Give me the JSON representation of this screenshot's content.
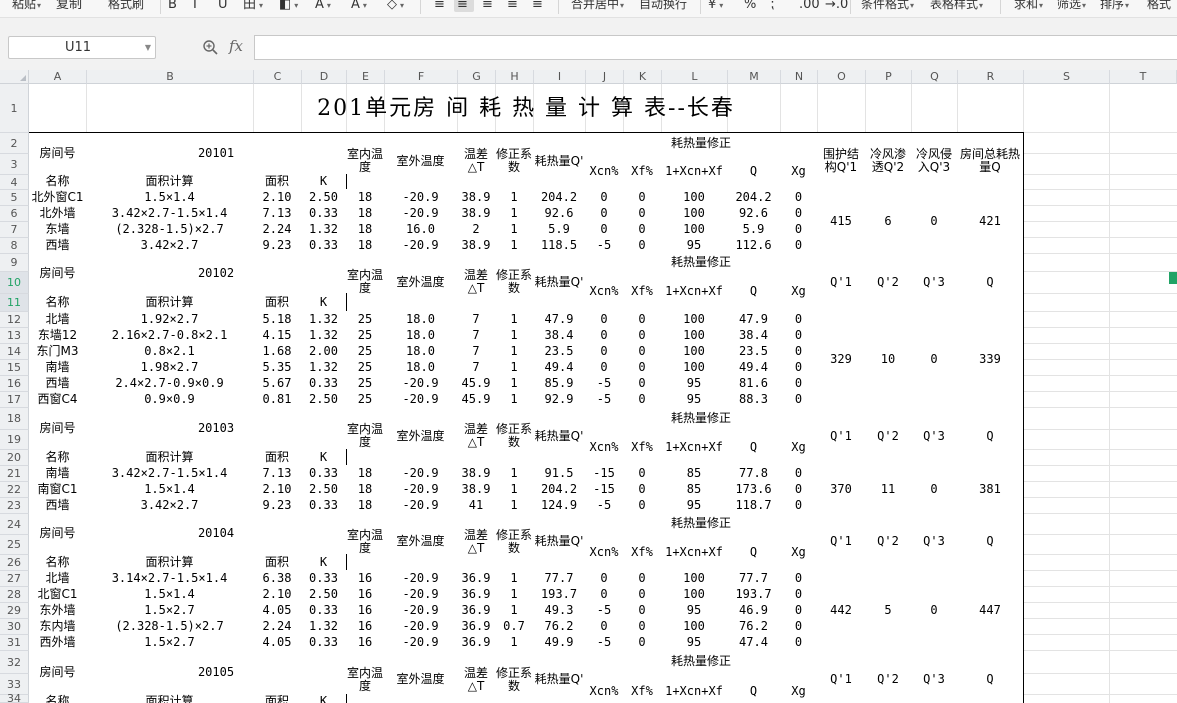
{
  "ribbon": [
    {
      "label": "粘贴",
      "has_caret": true
    },
    {
      "label": "复制",
      "icon": "copy-icon"
    },
    {
      "label": "格式刷"
    },
    {
      "label": "B",
      "icon": "bold-icon"
    },
    {
      "label": "I",
      "icon": "italic-icon"
    },
    {
      "label": "U",
      "icon": "underline-icon"
    },
    {
      "label": "田",
      "icon": "border-icon",
      "has_caret": true
    },
    {
      "label": "◧",
      "icon": "fill-color-icon",
      "has_caret": true
    },
    {
      "label": "A",
      "icon": "highlight-icon",
      "has_caret": true
    },
    {
      "label": "A",
      "icon": "font-color-icon",
      "has_caret": true
    },
    {
      "label": "◇",
      "icon": "clear-format-icon",
      "has_caret": true
    },
    {
      "label": "≡",
      "icon": "align-left-icon"
    },
    {
      "label": "≡",
      "icon": "align-center-icon"
    },
    {
      "label": "≡",
      "icon": "align-right-icon"
    },
    {
      "label": "≡",
      "icon": "justify-icon"
    },
    {
      "label": "≡",
      "icon": "distributed-icon"
    },
    {
      "label": "合并居中",
      "has_caret": true
    },
    {
      "label": "自动换行"
    },
    {
      "label": "¥",
      "icon": "currency-icon",
      "has_caret": true
    },
    {
      "label": "%",
      "icon": "percent-icon"
    },
    {
      "label": "⁏",
      "icon": "thousands-icon"
    },
    {
      "label": ".00",
      "icon": "increase-decimal-icon"
    },
    {
      "label": "→.0",
      "icon": "decrease-decimal-icon"
    },
    {
      "label": "条件格式",
      "has_caret": true
    },
    {
      "label": "表格样式",
      "has_caret": true
    },
    {
      "label": "求和",
      "has_caret": true
    },
    {
      "label": "筛选",
      "has_caret": true
    },
    {
      "label": "排序",
      "has_caret": true
    },
    {
      "label": "格式"
    }
  ],
  "formula_bar": {
    "name_box": "U11",
    "fx": "fx",
    "formula": ""
  },
  "columns": [
    "A",
    "B",
    "C",
    "D",
    "E",
    "F",
    "G",
    "H",
    "I",
    "J",
    "K",
    "L",
    "M",
    "N",
    "O",
    "P",
    "Q",
    "R",
    "S",
    "T"
  ],
  "rows": [
    "1",
    "2",
    "3",
    "4",
    "5",
    "6",
    "7",
    "8",
    "9",
    "10",
    "11",
    "12",
    "13",
    "14",
    "15",
    "16",
    "17",
    "18",
    "19",
    "20",
    "21",
    "22",
    "23",
    "24",
    "25",
    "26",
    "27",
    "28",
    "29",
    "30",
    "31",
    "32",
    "33",
    "34"
  ],
  "selected_rows": [
    "10",
    "11"
  ],
  "sheet": {
    "title": "201单元房 间 耗 热 量 计 算 表--长春",
    "h": {
      "room_no": "房间号",
      "name": "名称",
      "area_calc": "面积计算",
      "area": "面积",
      "k": "K",
      "t_in": "室内温度",
      "t_out": "室外温度",
      "dt": "温差△T",
      "coef": "修正系数",
      "heat": "耗热量Q'",
      "corr": "耗热量修正",
      "xcn": "Xcn%",
      "xf": "Xf%",
      "sum": "1+Xcn+Xf",
      "q": "Q",
      "xg": "Xg",
      "q1_full": "围护结构Q'1",
      "q2_full": "冷风渗透Q'2",
      "q3_full": "冷风侵入Q'3",
      "total_full": "房间总耗热量Q",
      "q1": "Q'1",
      "q2": "Q'2",
      "q3": "Q'3",
      "total": "Q"
    },
    "blocks": [
      {
        "room": "20101",
        "sum": {
          "q1": "415",
          "q2": "6",
          "q3": "0",
          "total": "421"
        },
        "rows": [
          [
            "北外窗C1",
            "1.5×1.4",
            "2.10",
            "2.50",
            "18",
            "-20.9",
            "38.9",
            "1",
            "204.2",
            "0",
            "0",
            "100",
            "204.2",
            "0"
          ],
          [
            "北外墙",
            "3.42×2.7-1.5×1.4",
            "7.13",
            "0.33",
            "18",
            "-20.9",
            "38.9",
            "1",
            "92.6",
            "0",
            "0",
            "100",
            "92.6",
            "0"
          ],
          [
            "东墙",
            "(2.328-1.5)×2.7",
            "2.24",
            "1.32",
            "18",
            "16.0",
            "2",
            "1",
            "5.9",
            "0",
            "0",
            "100",
            "5.9",
            "0"
          ],
          [
            "西墙",
            "3.42×2.7",
            "9.23",
            "0.33",
            "18",
            "-20.9",
            "38.9",
            "1",
            "118.5",
            "-5",
            "0",
            "95",
            "112.6",
            "0"
          ]
        ]
      },
      {
        "room": "20102",
        "sum": {
          "q1": "329",
          "q2": "10",
          "q3": "0",
          "total": "339"
        },
        "rows": [
          [
            "北墙",
            "1.92×2.7",
            "5.18",
            "1.32",
            "25",
            "18.0",
            "7",
            "1",
            "47.9",
            "0",
            "0",
            "100",
            "47.9",
            "0"
          ],
          [
            "东墙12",
            "2.16×2.7-0.8×2.1",
            "4.15",
            "1.32",
            "25",
            "18.0",
            "7",
            "1",
            "38.4",
            "0",
            "0",
            "100",
            "38.4",
            "0"
          ],
          [
            "东门M3",
            "0.8×2.1",
            "1.68",
            "2.00",
            "25",
            "18.0",
            "7",
            "1",
            "23.5",
            "0",
            "0",
            "100",
            "23.5",
            "0"
          ],
          [
            "南墙",
            "1.98×2.7",
            "5.35",
            "1.32",
            "25",
            "18.0",
            "7",
            "1",
            "49.4",
            "0",
            "0",
            "100",
            "49.4",
            "0"
          ],
          [
            "西墙",
            "2.4×2.7-0.9×0.9",
            "5.67",
            "0.33",
            "25",
            "-20.9",
            "45.9",
            "1",
            "85.9",
            "-5",
            "0",
            "95",
            "81.6",
            "0"
          ],
          [
            "西窗C4",
            "0.9×0.9",
            "0.81",
            "2.50",
            "25",
            "-20.9",
            "45.9",
            "1",
            "92.9",
            "-5",
            "0",
            "95",
            "88.3",
            "0"
          ]
        ]
      },
      {
        "room": "20103",
        "sum": {
          "q1": "370",
          "q2": "11",
          "q3": "0",
          "total": "381"
        },
        "rows": [
          [
            "南墙",
            "3.42×2.7-1.5×1.4",
            "7.13",
            "0.33",
            "18",
            "-20.9",
            "38.9",
            "1",
            "91.5",
            "-15",
            "0",
            "85",
            "77.8",
            "0"
          ],
          [
            "南窗C1",
            "1.5×1.4",
            "2.10",
            "2.50",
            "18",
            "-20.9",
            "38.9",
            "1",
            "204.2",
            "-15",
            "0",
            "85",
            "173.6",
            "0"
          ],
          [
            "西墙",
            "3.42×2.7",
            "9.23",
            "0.33",
            "18",
            "-20.9",
            "41",
            "1",
            "124.9",
            "-5",
            "0",
            "95",
            "118.7",
            "0"
          ]
        ]
      },
      {
        "room": "20104",
        "sum": {
          "q1": "442",
          "q2": "5",
          "q3": "0",
          "total": "447"
        },
        "rows": [
          [
            "北墙",
            "3.14×2.7-1.5×1.4",
            "6.38",
            "0.33",
            "16",
            "-20.9",
            "36.9",
            "1",
            "77.7",
            "0",
            "0",
            "100",
            "77.7",
            "0"
          ],
          [
            "北窗C1",
            "1.5×1.4",
            "2.10",
            "2.50",
            "16",
            "-20.9",
            "36.9",
            "1",
            "193.7",
            "0",
            "0",
            "100",
            "193.7",
            "0"
          ],
          [
            "东外墙",
            "1.5×2.7",
            "4.05",
            "0.33",
            "16",
            "-20.9",
            "36.9",
            "1",
            "49.3",
            "-5",
            "0",
            "95",
            "46.9",
            "0"
          ],
          [
            "东内墙",
            "(2.328-1.5)×2.7",
            "2.24",
            "1.32",
            "16",
            "-20.9",
            "36.9",
            "0.7",
            "76.2",
            "0",
            "0",
            "100",
            "76.2",
            "0"
          ],
          [
            "西外墙",
            "1.5×2.7",
            "4.05",
            "0.33",
            "16",
            "-20.9",
            "36.9",
            "1",
            "49.9",
            "-5",
            "0",
            "95",
            "47.4",
            "0"
          ]
        ]
      },
      {
        "room": "20105",
        "sum": null,
        "rows": []
      }
    ]
  }
}
